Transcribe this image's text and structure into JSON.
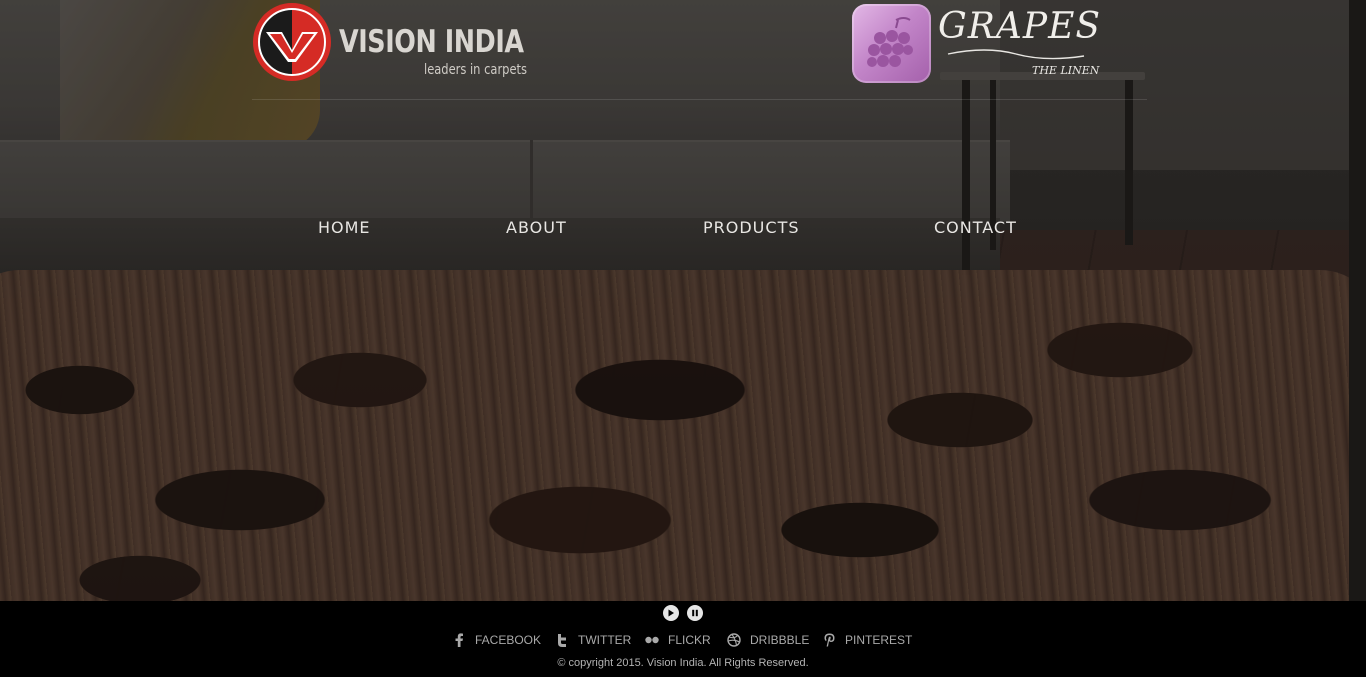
{
  "brand": {
    "title": "VISION INDIA",
    "tagline": "leaders in carpets"
  },
  "partner": {
    "name": "GRAPES",
    "subtitle": "THE LINEN"
  },
  "nav": {
    "items": [
      {
        "label": "HOME"
      },
      {
        "label": "ABOUT"
      },
      {
        "label": "PRODUCTS"
      },
      {
        "label": "CONTACT"
      }
    ]
  },
  "slider_controls": {
    "play_icon": "play-icon",
    "pause_icon": "pause-icon"
  },
  "social": [
    {
      "label": "FACEBOOK",
      "icon": "facebook-icon"
    },
    {
      "label": "TWITTER",
      "icon": "twitter-icon"
    },
    {
      "label": "FLICKR",
      "icon": "flickr-icon"
    },
    {
      "label": "DRIBBBLE",
      "icon": "dribbble-icon"
    },
    {
      "label": "PINTEREST",
      "icon": "pinterest-icon"
    }
  ],
  "footer": {
    "copyright": "© copyright 2015. Vision India. All Rights Reserved."
  },
  "colors": {
    "logo_red": "#d52b25",
    "grapes_purple": "#b879be",
    "footer_bg": "#000000",
    "footer_text": "#a9a9a9"
  }
}
